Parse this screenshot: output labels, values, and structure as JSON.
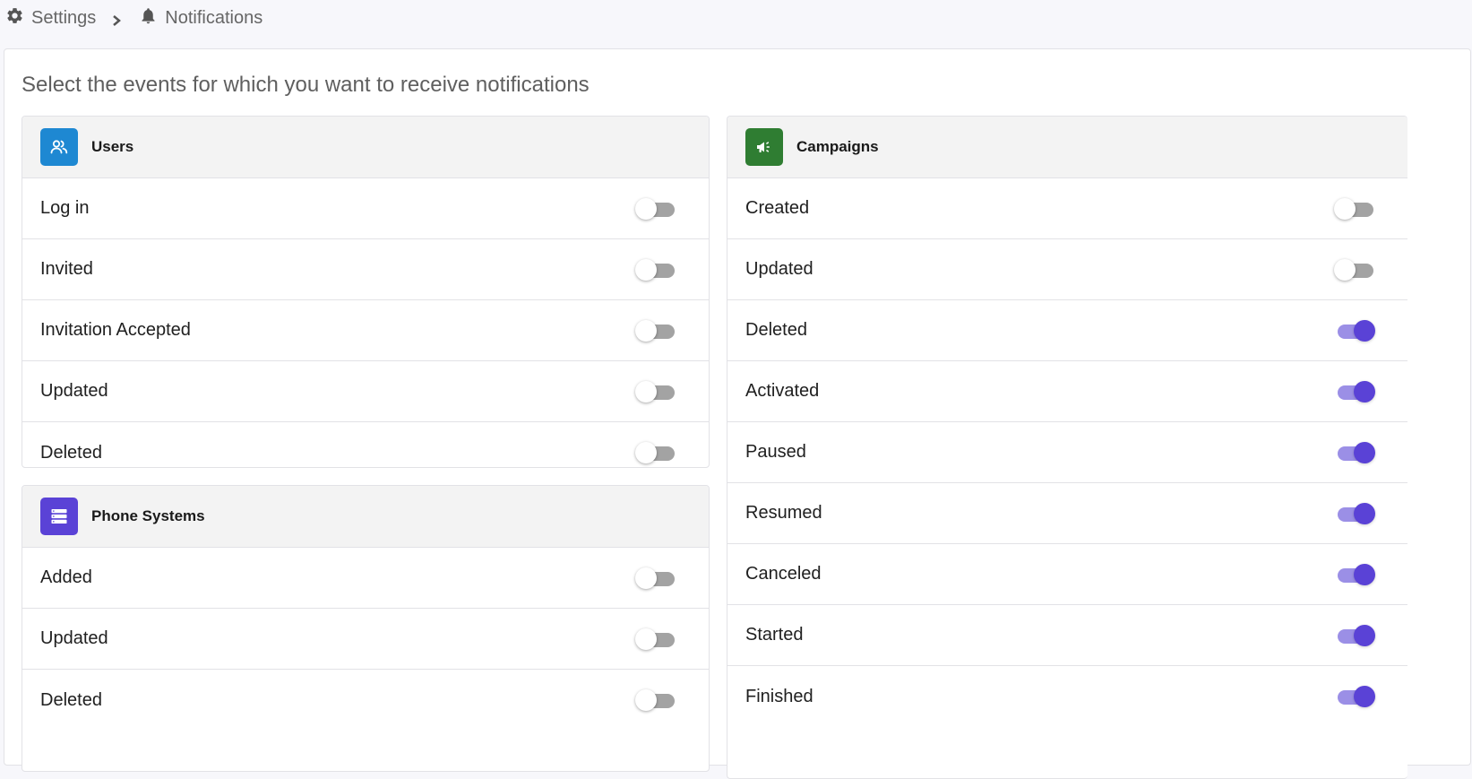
{
  "breadcrumb": {
    "settings": "Settings",
    "notifications": "Notifications"
  },
  "heading": "Select the events for which you want to receive notifications",
  "colors": {
    "users_icon_bg": "#1e88d2",
    "phone_icon_bg": "#5a42d6",
    "campaigns_icon_bg": "#2f7d32",
    "toggle_on": "#5a42d6",
    "toggle_off_track": "#a3a3a3"
  },
  "users": {
    "title": "Users",
    "icon": "users-icon",
    "items": [
      {
        "label": "Log in",
        "enabled": false
      },
      {
        "label": "Invited",
        "enabled": false
      },
      {
        "label": "Invitation Accepted",
        "enabled": false
      },
      {
        "label": "Updated",
        "enabled": false
      },
      {
        "label": "Deleted",
        "enabled": false
      }
    ]
  },
  "phone_systems": {
    "title": "Phone Systems",
    "icon": "server-list-icon",
    "items": [
      {
        "label": "Added",
        "enabled": false
      },
      {
        "label": "Updated",
        "enabled": false
      },
      {
        "label": "Deleted",
        "enabled": false
      }
    ]
  },
  "campaigns": {
    "title": "Campaigns",
    "icon": "megaphone-icon",
    "items": [
      {
        "label": "Created",
        "enabled": false
      },
      {
        "label": "Updated",
        "enabled": false
      },
      {
        "label": "Deleted",
        "enabled": true
      },
      {
        "label": "Activated",
        "enabled": true
      },
      {
        "label": "Paused",
        "enabled": true
      },
      {
        "label": "Resumed",
        "enabled": true
      },
      {
        "label": "Canceled",
        "enabled": true
      },
      {
        "label": "Started",
        "enabled": true
      },
      {
        "label": "Finished",
        "enabled": true
      }
    ]
  }
}
